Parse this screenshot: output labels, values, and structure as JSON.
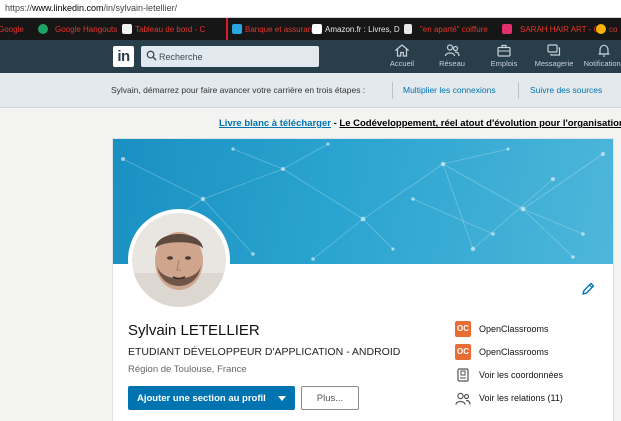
{
  "browser": {
    "url_prefix": "https://",
    "url_host": "www.linkedin.com",
    "url_path": "/in/sylvain-letellier/"
  },
  "bookmarks": [
    {
      "label": "Google",
      "icon": "google-icon",
      "color": "#e8e8e8"
    },
    {
      "label": "Google Hangouts",
      "icon": "hangouts-icon",
      "color": "#1fa463"
    },
    {
      "label": "Tableau de bord - C",
      "icon": "dashboard-icon",
      "color": "#f2f2f2"
    },
    {
      "label": "Banque et assurance",
      "icon": "bank-icon",
      "color": "#29a6e0"
    },
    {
      "label": "Amazon.fr : Livres, D",
      "icon": "amazon-icon",
      "color": "#ffffff"
    },
    {
      "label": "\"en aparté\" coiffure",
      "icon": "document-icon",
      "color": "#e8e8e8"
    },
    {
      "label": "SARAH HAIR ART - C",
      "icon": "instagram-icon",
      "color": "#e1306c"
    },
    {
      "label": "co",
      "icon": "chrome-icon",
      "color": "#f4b400"
    }
  ],
  "navbar": {
    "logo_text": "in",
    "search_placeholder": "Recherche",
    "items": [
      {
        "label": "Accueil",
        "icon": "home-icon"
      },
      {
        "label": "Réseau",
        "icon": "network-icon"
      },
      {
        "label": "Emplois",
        "icon": "briefcase-icon"
      },
      {
        "label": "Messagerie",
        "icon": "messaging-icon"
      },
      {
        "label": "Notifications",
        "icon": "bell-icon"
      }
    ]
  },
  "guidance": {
    "prompt": "Sylvain, démarrez pour faire avancer votre carrière en trois étapes :",
    "link1": "Multiplier les connexions",
    "link2": "Suivre des sources"
  },
  "ad": {
    "link": "Livre blanc à télécharger",
    "separator": " - ",
    "text": "Le Codéveloppement, réel atout d'évolution pour l'organisation"
  },
  "profile": {
    "name": "Sylvain LETELLIER",
    "headline": "ETUDIANT DÉVELOPPEUR D'APPLICATION - ANDROID",
    "location": "Région de Toulouse, France",
    "primary_button": "Ajouter une section au profil",
    "secondary_button": "Plus...",
    "side": [
      {
        "label": "OpenClassrooms",
        "icon": "openclassrooms-logo"
      },
      {
        "label": "OpenClassrooms",
        "icon": "openclassrooms-logo"
      },
      {
        "label": "Voir les coordonnées",
        "icon": "contact-card-icon"
      },
      {
        "label": "Voir les relations (11)",
        "icon": "people-icon"
      }
    ]
  },
  "colors": {
    "linkedin_blue": "#0073b1",
    "navbar": "#283e4a",
    "openclassrooms": "#e86c33"
  }
}
